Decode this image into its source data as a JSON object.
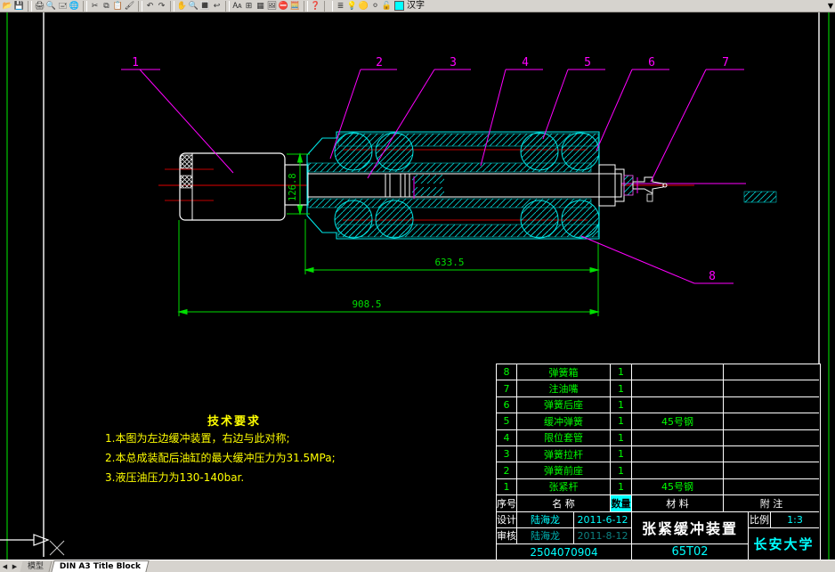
{
  "colors": {
    "bg": "#000000",
    "geometry_cyan": "#00e5e5",
    "dimension_green": "#00dd00",
    "callout_magenta": "#ff00ff",
    "centerline_red": "#ff0000",
    "techreq_yellow": "#ffff00",
    "table_text_green": "#00ff00",
    "table_value_cyan": "#00ffff"
  },
  "toolbar": {
    "icons": [
      "📂",
      "💾",
      "🖨",
      "🔍",
      "🖃",
      "🌐",
      "✂",
      "⧉",
      "📋",
      "🖌",
      "↶",
      "↷",
      "✋",
      "🔍",
      "🔳",
      "↩",
      "🗛",
      "⊞",
      "▦",
      "🖼",
      "⛔",
      "🧮",
      "❓",
      "≣",
      "💡",
      "🟡",
      "⚪",
      "🔓"
    ],
    "layer_name": "汉字",
    "overflow_arrow": "▼"
  },
  "tabs": {
    "nav_prev": "◀",
    "nav_next": "▶",
    "model": "模型",
    "layout": "DIN A3 Title Block"
  },
  "drawing": {
    "callouts": [
      "1",
      "2",
      "3",
      "4",
      "5",
      "6",
      "7",
      "8"
    ],
    "dims": [
      "126.8",
      "633.5",
      "908.5"
    ]
  },
  "tech_requirements": {
    "title": "技术要求",
    "line1": "1.本图为左边缓冲装置，右边与此对称;",
    "line2": "2.本总成装配后油缸的最大缓冲压力为31.5MPa;",
    "line3": "3.液压油压力为130-140bar."
  },
  "title_block": {
    "parts": [
      {
        "no": "8",
        "name": "弹簧箱",
        "qty": "1",
        "material": "",
        "note": ""
      },
      {
        "no": "7",
        "name": "注油嘴",
        "qty": "1",
        "material": "",
        "note": ""
      },
      {
        "no": "6",
        "name": "弹簧后座",
        "qty": "1",
        "material": "",
        "note": ""
      },
      {
        "no": "5",
        "name": "缓冲弹簧",
        "qty": "1",
        "material": "45号钢",
        "note": ""
      },
      {
        "no": "4",
        "name": "限位套管",
        "qty": "1",
        "material": "",
        "note": ""
      },
      {
        "no": "3",
        "name": "弹簧拉杆",
        "qty": "1",
        "material": "",
        "note": ""
      },
      {
        "no": "2",
        "name": "弹簧前座",
        "qty": "1",
        "material": "",
        "note": ""
      },
      {
        "no": "1",
        "name": "张紧杆",
        "qty": "1",
        "material": "45号钢",
        "note": ""
      }
    ],
    "header": {
      "no": "序号",
      "name": "名  称",
      "qty": "数量",
      "material": "材  料",
      "note": "附  注"
    },
    "design_label": "设计",
    "design_name": "陆海龙",
    "design_date": "2011-6-12",
    "check_label": "审核",
    "check_name": "陆海龙",
    "check_date": "2011-8-12",
    "scale_label": "比例",
    "scale_value": "1:3",
    "title": "张紧缓冲装置",
    "student_id": "2504070904",
    "drawing_no": "65T02",
    "university": "长安大学"
  }
}
